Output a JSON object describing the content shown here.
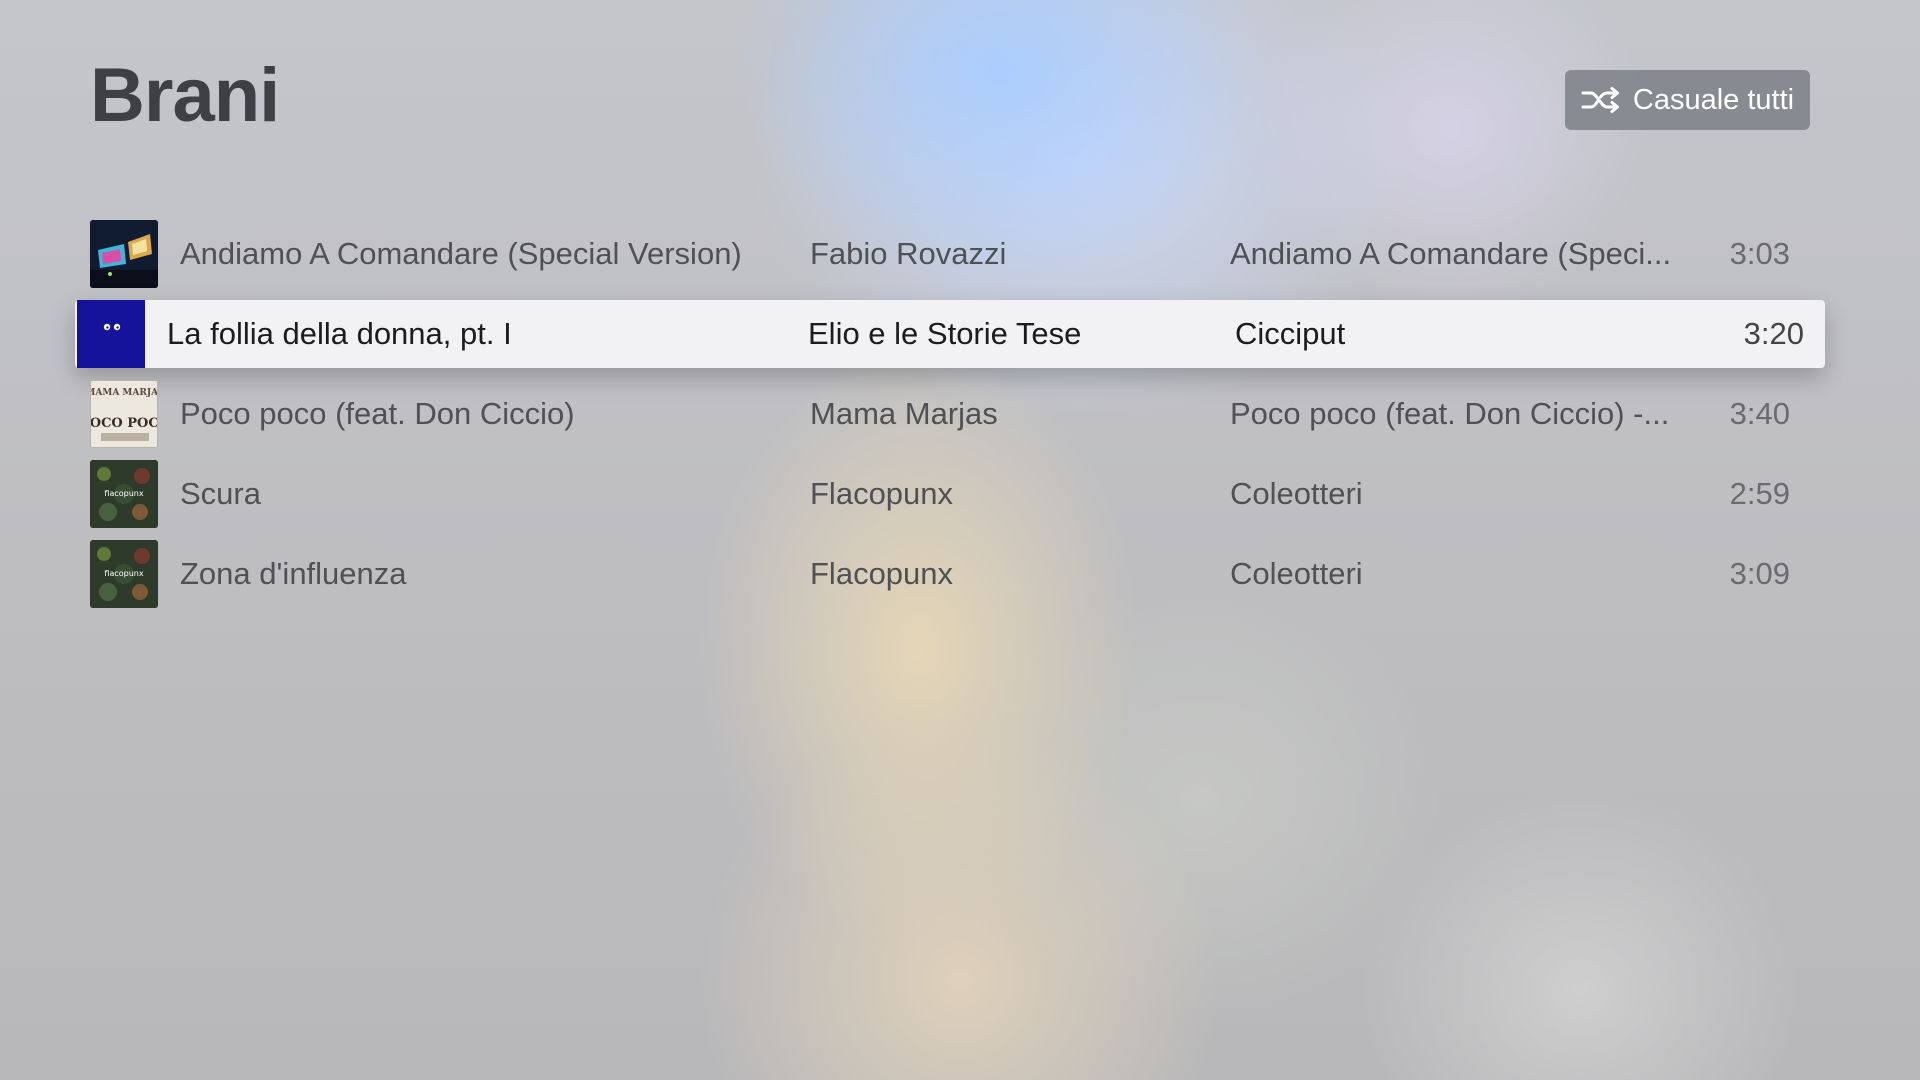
{
  "header": {
    "title": "Brani",
    "shuffle_label": "Casuale tutti"
  },
  "tracks": [
    {
      "title": "Andiamo A Comandare (Special Version)",
      "artist": "Fabio Rovazzi",
      "album": "Andiamo A Comandare (Speci...",
      "duration": "3:03",
      "artwork": "album-art-neon-stage"
    },
    {
      "title": "La follia della donna, pt. I",
      "artist": "Elio e le Storie Tese",
      "album": "Cicciput",
      "duration": "3:20",
      "artwork": "album-art-blue-eyes",
      "selected": true
    },
    {
      "title": "Poco poco (feat. Don Ciccio)",
      "artist": "Mama Marjas",
      "album": "Poco poco (feat. Don Ciccio) -...",
      "duration": "3:40",
      "artwork": "album-art-mama-marjas",
      "art_text": [
        "MAMA MARJAS",
        "POCO POCO"
      ]
    },
    {
      "title": "Scura",
      "artist": "Flacopunx",
      "album": "Coleotteri",
      "duration": "2:59",
      "artwork": "album-art-flacopunx",
      "art_text": [
        "flacopunx"
      ]
    },
    {
      "title": "Zona d'influenza",
      "artist": "Flacopunx",
      "album": "Coleotteri",
      "duration": "3:09",
      "artwork": "album-art-flacopunx",
      "art_text": [
        "flacopunx"
      ]
    }
  ],
  "colors": {
    "title": "#3f4043",
    "row_text": "#505155",
    "selected_row_bg": "#f2f2f4",
    "selected_text": "#1c1c1e",
    "shuffle_button_bg": "#7d8087",
    "cicciput_blue": "#14139a"
  }
}
